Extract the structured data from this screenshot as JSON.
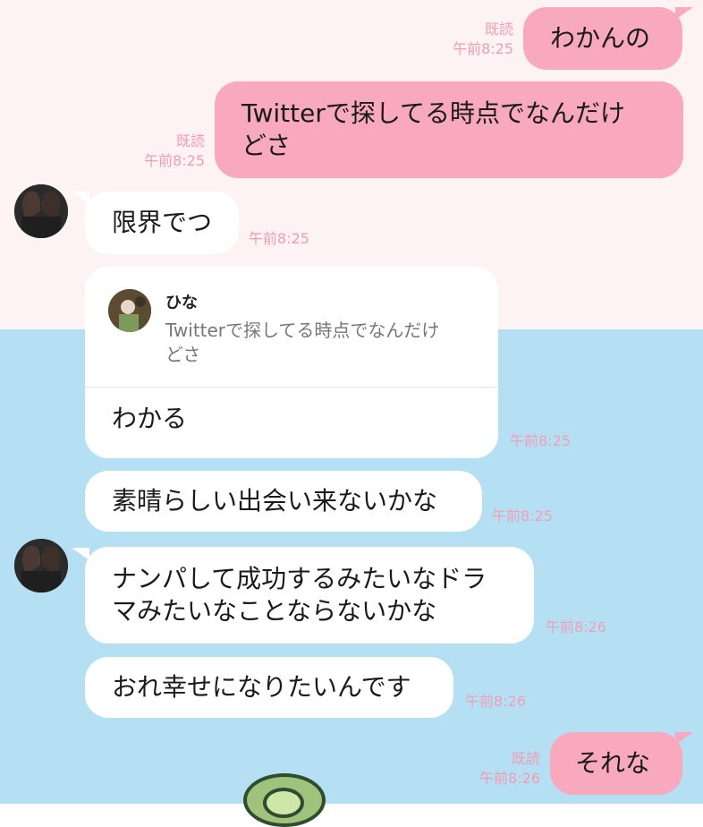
{
  "labels": {
    "read": "既読"
  },
  "messages": [
    {
      "dir": "out",
      "text": "わかんの",
      "time": "午前8:25"
    },
    {
      "dir": "out",
      "text": "Twitterで探してる時点でなんだけ\nどさ",
      "time": "午前8:25"
    },
    {
      "dir": "in",
      "text": "限界でつ",
      "time": "午前8:25"
    },
    {
      "dir": "in",
      "text": "わかる",
      "time": "午前8:25",
      "reply": {
        "name": "ひな",
        "text": "Twitterで探してる時点でなんだけ\nどさ"
      }
    },
    {
      "dir": "in",
      "text": "素晴らしい出会い来ないかな",
      "time": "午前8:25"
    },
    {
      "dir": "in",
      "text": "ナンパして成功するみたいなドラ\nマみたいなことならないかな",
      "time": "午前8:26"
    },
    {
      "dir": "in",
      "text": "おれ幸せになりたいんです",
      "time": "午前8:26"
    },
    {
      "dir": "out",
      "text": "それな",
      "time": "午前8:26"
    }
  ],
  "colors": {
    "outgoing_bubble": "#f8a9bd",
    "incoming_bubble": "#ffffff",
    "background_top": "#fdf3f5",
    "background_bottom": "#b5dff3",
    "meta_text": "#f29cb2"
  }
}
